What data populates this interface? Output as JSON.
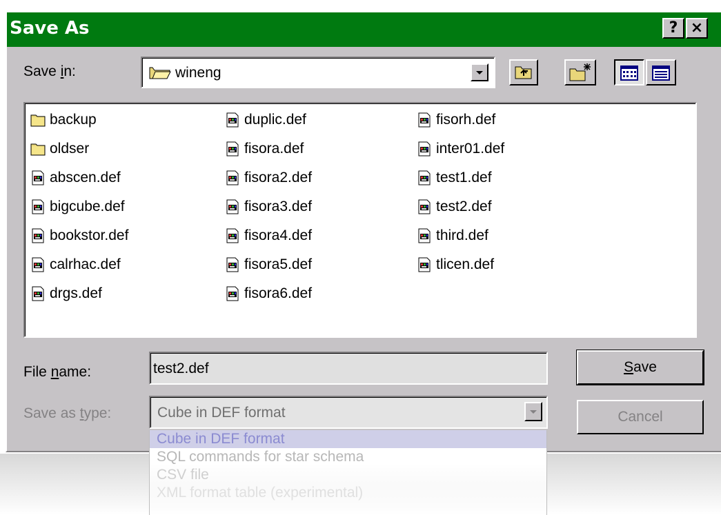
{
  "window": {
    "title": "Save As",
    "help_label": "?",
    "close_label": "×"
  },
  "toolbar": {
    "save_in_label_pre": "Save ",
    "save_in_label_u": "i",
    "save_in_label_post": "n:",
    "save_in_value": "wineng"
  },
  "files": {
    "col1": [
      {
        "name": "backup",
        "type": "folder"
      },
      {
        "name": "oldser",
        "type": "folder"
      },
      {
        "name": "abscen.def",
        "type": "file"
      },
      {
        "name": "bigcube.def",
        "type": "file"
      },
      {
        "name": "bookstor.def",
        "type": "file"
      },
      {
        "name": "calrhac.def",
        "type": "file"
      },
      {
        "name": "drgs.def",
        "type": "file"
      }
    ],
    "col2": [
      {
        "name": "duplic.def",
        "type": "file"
      },
      {
        "name": "fisora.def",
        "type": "file"
      },
      {
        "name": "fisora2.def",
        "type": "file"
      },
      {
        "name": "fisora3.def",
        "type": "file"
      },
      {
        "name": "fisora4.def",
        "type": "file"
      },
      {
        "name": "fisora5.def",
        "type": "file"
      },
      {
        "name": "fisora6.def",
        "type": "file"
      }
    ],
    "col3": [
      {
        "name": "fisorh.def",
        "type": "file"
      },
      {
        "name": "inter01.def",
        "type": "file"
      },
      {
        "name": "test1.def",
        "type": "file"
      },
      {
        "name": "test2.def",
        "type": "file"
      },
      {
        "name": "third.def",
        "type": "file"
      },
      {
        "name": "tlicen.def",
        "type": "file"
      }
    ]
  },
  "form": {
    "filename_label_pre": "File ",
    "filename_label_u": "n",
    "filename_label_post": "ame:",
    "filename_value": "test2.def",
    "type_label_pre": "Save as ",
    "type_label_u": "t",
    "type_label_post": "ype:",
    "type_value": "Cube in DEF format"
  },
  "buttons": {
    "save_u": "S",
    "save_rest": "ave",
    "cancel": "Cancel"
  },
  "dropdown_options": [
    "Cube in DEF format",
    "SQL commands for star schema",
    "CSV file",
    "XML format table (experimental)"
  ],
  "colors": {
    "titlebar": "#007a10",
    "face": "#c6c3c6",
    "highlight": "#cfcfe8"
  }
}
